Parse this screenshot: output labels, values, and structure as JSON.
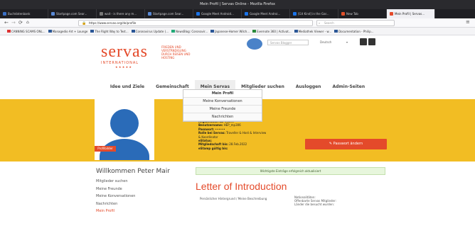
{
  "window": {
    "title": "Mein Profil | Servas Online - Mozilla Firefox"
  },
  "tabs": [
    {
      "label": "Buchdatenbank",
      "color": "#3a6fc4"
    },
    {
      "label": "Startpage.com Sear...",
      "color": "#5a8ad6"
    },
    {
      "label": "wait - is there any m...",
      "color": "#2b2b2b"
    },
    {
      "label": "Startpage.com Sear...",
      "color": "#5a8ad6"
    },
    {
      "label": "Google Meet Android...",
      "color": "#1a73e8"
    },
    {
      "label": "Google Meet Androi...",
      "color": "#1a73e8"
    },
    {
      "label": "[Git Kind] in the Gar...",
      "color": "#1a73e8"
    },
    {
      "label": "New Tab",
      "color": "#e0502a"
    },
    {
      "label": "Mein Profil | Servas...",
      "color": "#e44a2a",
      "active": true
    }
  ],
  "url": "https://www.servas.org/de/profile",
  "search_placeholder": "Search",
  "bookmarks": [
    "CANNING SCAMS ONL...",
    "Managedio Art + Lounge",
    "The Right Way to Test...",
    "Coronavirus Update (...",
    "NewsBlog: Coronavir...",
    "Japanese-Homer Wilch...",
    "Evernote 360 | Activat...",
    "Mediathek Viewer - w...",
    "Documentation - Philip..."
  ],
  "logo": {
    "brand": "servas",
    "brand_sub": "INTERNATIONAL",
    "tagline_1": "FRIEDEN UND",
    "tagline_2": "VERSTÄNDIGUNG",
    "tagline_3": "DURCH REISEN UND",
    "tagline_4": "HOSTING"
  },
  "header_search": {
    "placeholder": "Servas Blogger",
    "lang": "Deutsch"
  },
  "nav": {
    "items": [
      "Idee und Ziele",
      "Gemeinschaft",
      "Mein Servas",
      "Mitglieder suchen",
      "Ausloggen",
      "Admin-Seiten"
    ]
  },
  "subnav": {
    "left": "Begrüßung",
    "right": "Kontakt"
  },
  "dropdown": {
    "items": [
      "Mein Profil",
      "Meine Konversationen",
      "Meine Freunde",
      "Nachrichten"
    ]
  },
  "avatar": {
    "tag": "Profilbilder"
  },
  "details": [
    {
      "label": "Registration-Id:",
      "value": "Sybille"
    },
    {
      "label": "Benutzername:",
      "value": "HEP_mp306"
    },
    {
      "label": "Passwort:",
      "value": "••••••"
    },
    {
      "label": "Rolle bei Servas:",
      "value": "Traveller & Host & Interview"
    },
    {
      "label": "",
      "value": "& Koordinator"
    },
    {
      "label": "eStatus:",
      "value": ""
    },
    {
      "label": "Mitgliedschaft bis:",
      "value": "28.Feb.2022"
    },
    {
      "label": "eStamp gültig bis:",
      "value": ""
    }
  ],
  "password_button": "✎ Passwort ändern",
  "welcome": "Willkommen Peter Mair",
  "side_menu": [
    "Mitglieder suchen",
    "Meine Freunde",
    "Meine Konversationen",
    "Nachrichten",
    "Mein Profil"
  ],
  "alert": "Wichtigste Einträge erfolgreich aktualisiert",
  "letter_title": "Letter of Introduction",
  "personal_label": "Persönlicher Hintergrund / Meine Beschreibung",
  "right_note": [
    "Nationalitäten:",
    "Offenbarte Servas Mitglieder:",
    "Länder die besucht wurden:"
  ]
}
